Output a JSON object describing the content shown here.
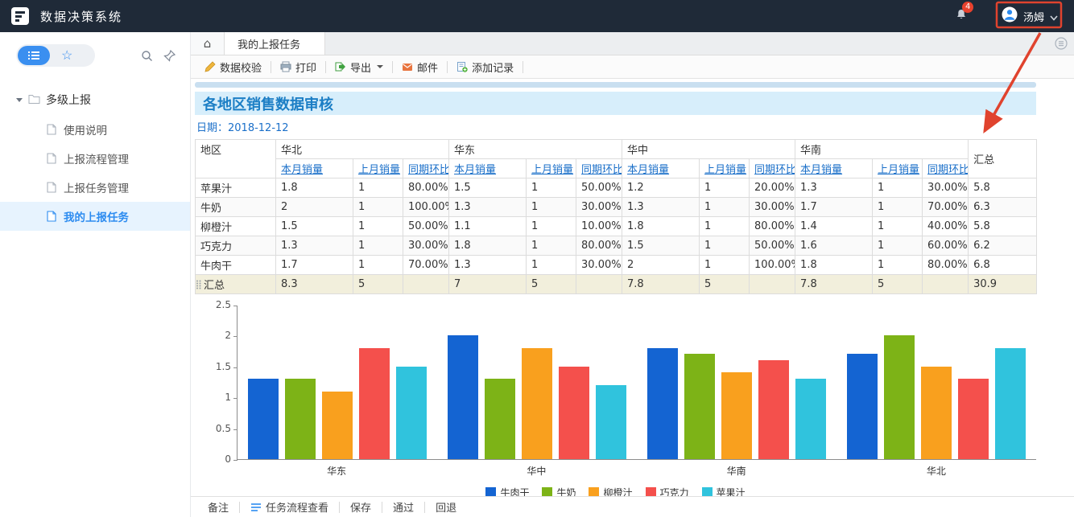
{
  "topbar": {
    "app_title": "数据决策系统",
    "notification_count": "4",
    "user_name": "汤姆"
  },
  "sidebar": {
    "star_icon": "☆",
    "root_folder": "多级上报",
    "items": [
      {
        "name": "usage-note",
        "label": "使用说明",
        "active": false
      },
      {
        "name": "report-flow-management",
        "label": "上报流程管理",
        "active": false
      },
      {
        "name": "report-task-management",
        "label": "上报任务管理",
        "active": false
      },
      {
        "name": "my-report-tasks",
        "label": "我的上报任务",
        "active": true
      }
    ]
  },
  "tabbar": {
    "home_icon": "⌂",
    "active_tab": "我的上报任务"
  },
  "toolbar": {
    "items": [
      {
        "name": "data-verify-button",
        "label": "数据校验",
        "icon": "verify-icon"
      },
      {
        "name": "print-button",
        "label": "打印",
        "icon": "printer-icon"
      },
      {
        "name": "export-button",
        "label": "导出",
        "icon": "export-icon",
        "has_caret": true
      },
      {
        "name": "mail-button",
        "label": "邮件",
        "icon": "mail-icon"
      },
      {
        "name": "add-record-button",
        "label": "添加记录",
        "icon": "add-record-icon"
      }
    ]
  },
  "report": {
    "title": "各地区销售数据审核",
    "date_label": "日期：2018-12-12",
    "table": {
      "region_col_header": "地区",
      "regions": [
        "华北",
        "华东",
        "华中",
        "华南"
      ],
      "total_header": "汇总",
      "sub_headers": [
        "本月销量",
        "上月销量",
        "同期环比"
      ],
      "rows": [
        {
          "name": "苹果汁",
          "cells": [
            [
              "1.8",
              "1",
              "80.00%"
            ],
            [
              "1.5",
              "1",
              "50.00%"
            ],
            [
              "1.2",
              "1",
              "20.00%"
            ],
            [
              "1.3",
              "1",
              "30.00%"
            ]
          ],
          "total": "5.8"
        },
        {
          "name": "牛奶",
          "cells": [
            [
              "2",
              "1",
              "100.00%"
            ],
            [
              "1.3",
              "1",
              "30.00%"
            ],
            [
              "1.3",
              "1",
              "30.00%"
            ],
            [
              "1.7",
              "1",
              "70.00%"
            ]
          ],
          "total": "6.3"
        },
        {
          "name": "柳橙汁",
          "cells": [
            [
              "1.5",
              "1",
              "50.00%"
            ],
            [
              "1.1",
              "1",
              "10.00%"
            ],
            [
              "1.8",
              "1",
              "80.00%"
            ],
            [
              "1.4",
              "1",
              "40.00%"
            ]
          ],
          "total": "5.8"
        },
        {
          "name": "巧克力",
          "cells": [
            [
              "1.3",
              "1",
              "30.00%"
            ],
            [
              "1.8",
              "1",
              "80.00%"
            ],
            [
              "1.5",
              "1",
              "50.00%"
            ],
            [
              "1.6",
              "1",
              "60.00%"
            ]
          ],
          "total": "6.2"
        },
        {
          "name": "牛肉干",
          "cells": [
            [
              "1.7",
              "1",
              "70.00%"
            ],
            [
              "1.3",
              "1",
              "30.00%"
            ],
            [
              "2",
              "1",
              "100.00%"
            ],
            [
              "1.8",
              "1",
              "80.00%"
            ]
          ],
          "total": "6.8"
        }
      ],
      "summary_row": {
        "name": "汇总",
        "cells": [
          [
            "8.3",
            "5",
            ""
          ],
          [
            "7",
            "5",
            ""
          ],
          [
            "7.8",
            "5",
            ""
          ],
          [
            "7.8",
            "5",
            ""
          ]
        ],
        "total": "30.9"
      }
    }
  },
  "chart_data": {
    "type": "bar",
    "categories": [
      "华东",
      "华中",
      "华南",
      "华北"
    ],
    "series": [
      {
        "name": "牛肉干",
        "color": "#1464d2",
        "values": [
          1.3,
          2,
          1.8,
          1.7
        ]
      },
      {
        "name": "牛奶",
        "color": "#7db317",
        "values": [
          1.3,
          1.3,
          1.7,
          2
        ]
      },
      {
        "name": "柳橙汁",
        "color": "#f9a01e",
        "values": [
          1.1,
          1.8,
          1.4,
          1.5
        ]
      },
      {
        "name": "巧克力",
        "color": "#f4504c",
        "values": [
          1.8,
          1.5,
          1.6,
          1.3
        ]
      },
      {
        "name": "苹果汁",
        "color": "#30c3dd",
        "values": [
          1.5,
          1.2,
          1.3,
          1.8
        ]
      }
    ],
    "title": "",
    "xlabel": "",
    "ylabel": "",
    "ylim": [
      0,
      2.5
    ],
    "yticks": [
      0,
      0.5,
      1,
      1.5,
      2,
      2.5
    ],
    "grid": false,
    "legend_position": "bottom"
  },
  "footer": {
    "items": [
      {
        "name": "remark-button",
        "label": "备注"
      },
      {
        "name": "task-flow-view-button",
        "label": "任务流程查看",
        "icon": "flow-icon"
      },
      {
        "name": "save-button",
        "label": "保存"
      },
      {
        "name": "approve-button",
        "label": "通过"
      },
      {
        "name": "rollback-button",
        "label": "回退"
      }
    ]
  },
  "colors": {
    "accent": "#2d8cf0",
    "annotation": "#e0432e",
    "topbar_bg": "#1f2a38",
    "banner_bg": "#d7eefb",
    "summary_row_bg": "#f2efdc"
  }
}
